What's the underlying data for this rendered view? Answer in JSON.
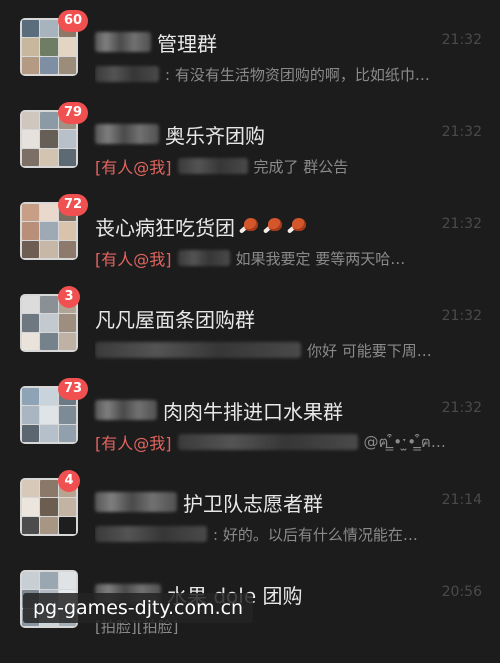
{
  "chats": [
    {
      "badge": "60",
      "name": "管理群",
      "time": "21:32",
      "mention": "",
      "message": ": 有没有生活物资团购的啊，比如纸巾…",
      "emoji": []
    },
    {
      "badge": "79",
      "name": "奥乐齐团购",
      "time": "21:32",
      "mention": "[有人@我]",
      "message": "完成了 群公告",
      "emoji": []
    },
    {
      "badge": "72",
      "name": "丧心病狂吃货团",
      "time": "21:32",
      "mention": "[有人@我]",
      "message": "如果我要定 要等两天哈…",
      "emoji": [
        "meat-icon",
        "meat-icon",
        "meat-icon"
      ]
    },
    {
      "badge": "3",
      "name": "凡凡屋面条团购群",
      "time": "21:32",
      "mention": "",
      "message": "你好 可能要下周…",
      "emoji": []
    },
    {
      "badge": "73",
      "name": "肉肉牛排进口水果群",
      "time": "21:32",
      "mention": "[有人@我]",
      "message": "@ฅ ̳͒•ˑ̫• ̳͒ฅ…",
      "emoji": []
    },
    {
      "badge": "4",
      "name": "护卫队志愿者群",
      "time": "21:14",
      "mention": "",
      "message": ": 好的。以后有什么情况能在…",
      "emoji": []
    },
    {
      "badge": "",
      "name": "水果 dole 团购",
      "time": "20:56",
      "mention": "",
      "message": "[拍脸][拍脸]",
      "emoji": []
    }
  ],
  "watermark": "pg-games-djty.com.cn",
  "colors": {
    "background": "#1c1c1c",
    "badge": "#f05050",
    "mention": "#e1655f",
    "name": "#e8e8e8",
    "message": "#8a8a8a",
    "time": "#4a4a4a"
  }
}
